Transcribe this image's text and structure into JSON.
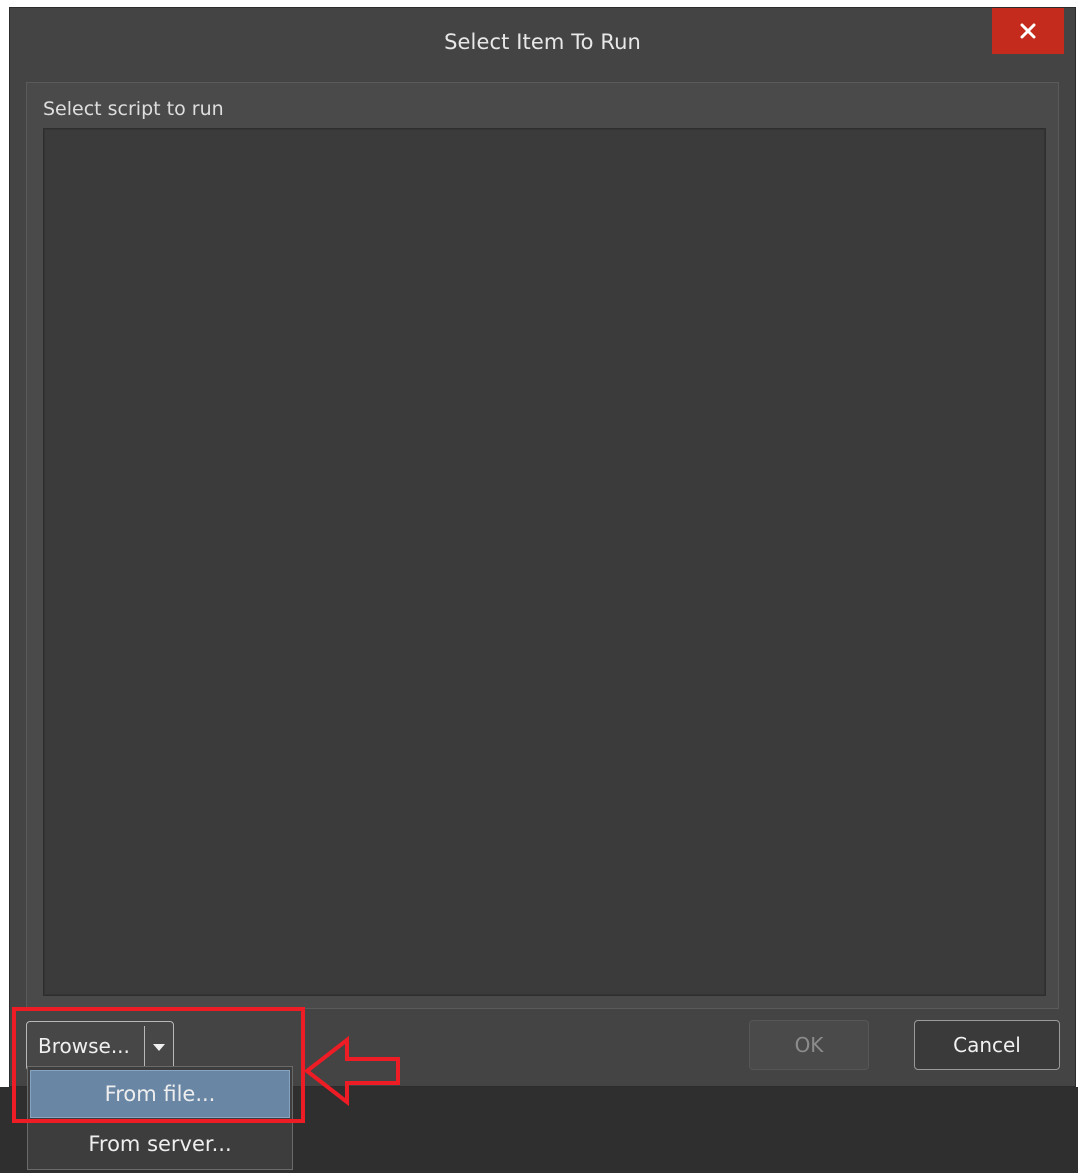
{
  "dialog": {
    "title": "Select Item To Run",
    "close_label": "×"
  },
  "content": {
    "section_label": "Select script to run",
    "script_list": []
  },
  "buttons": {
    "browse_label": "Browse...",
    "ok_label": "OK",
    "ok_enabled": false,
    "cancel_label": "Cancel"
  },
  "dropdown": {
    "items": [
      {
        "label": "From file...",
        "highlighted": true
      },
      {
        "label": "From server...",
        "highlighted": false
      }
    ]
  },
  "colors": {
    "close_button": "#c42b1c",
    "highlight_item": "#6987a5",
    "annotation": "#ee1c24"
  },
  "icons": {
    "close": "close-icon",
    "dropdown": "chevron-down-icon",
    "annotation": "arrow-left-icon"
  }
}
